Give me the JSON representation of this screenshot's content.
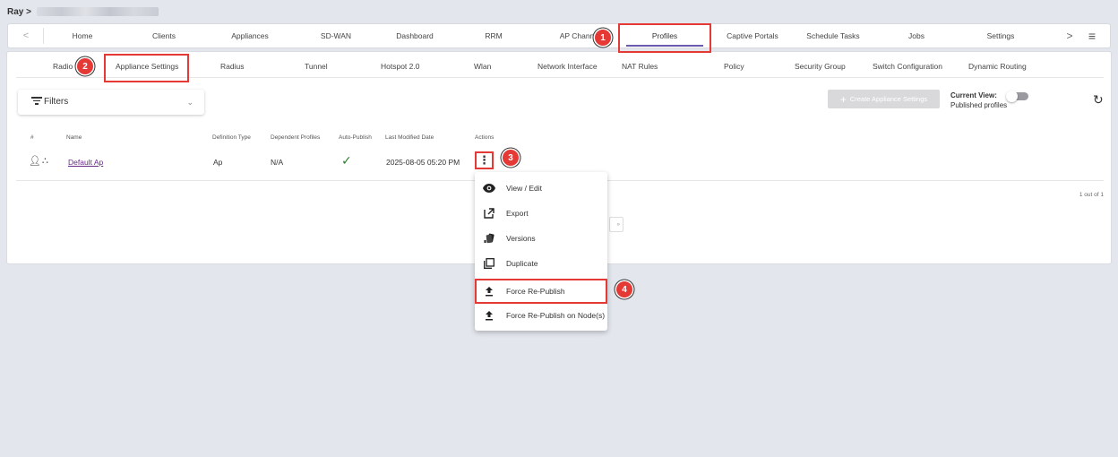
{
  "breadcrumb": {
    "root": "Ray >"
  },
  "top_nav": {
    "prev_arrow": "<",
    "next_arrow": ">",
    "menu_icon": "≡",
    "tabs": [
      {
        "label": "Home"
      },
      {
        "label": "Clients"
      },
      {
        "label": "Appliances"
      },
      {
        "label": "SD-WAN"
      },
      {
        "label": "Dashboard"
      },
      {
        "label": "RRM"
      },
      {
        "label": "AP Chann"
      },
      {
        "label": "Profiles"
      },
      {
        "label": "Captive Portals"
      },
      {
        "label": "Schedule Tasks"
      },
      {
        "label": "Jobs"
      },
      {
        "label": "Settings"
      }
    ],
    "active_tab": "Profiles"
  },
  "sub_nav": {
    "tabs": [
      {
        "label": "Radio"
      },
      {
        "label": "Appliance Settings"
      },
      {
        "label": "Radius"
      },
      {
        "label": "Tunnel"
      },
      {
        "label": "Hotspot 2.0"
      },
      {
        "label": "Wlan"
      },
      {
        "label": "Network Interface"
      },
      {
        "label": "NAT Rules"
      },
      {
        "label": "Policy"
      },
      {
        "label": "Security Group"
      },
      {
        "label": "Switch Configuration"
      },
      {
        "label": "Dynamic Routing"
      }
    ],
    "active_tab": "Appliance Settings"
  },
  "toolbar": {
    "filters_label": "Filters",
    "filters_chevron": "⌄",
    "create_plus": "+",
    "create_label": "Create Appliance Settings",
    "current_view_label": "Current View:",
    "current_view_value": "Published profiles",
    "refresh_icon": "↻"
  },
  "table": {
    "headers": [
      "#",
      "Name",
      "Definition Type",
      "Dependent Profiles",
      "Auto-Publish",
      "Last Modified Date",
      "Actions"
    ],
    "rows": [
      {
        "name": "Default Ap",
        "definition_type": "Ap",
        "dependent_profiles": "N/A",
        "auto_publish_icon": "✓",
        "last_modified": "2025-08-05 05:20 PM",
        "actions_icon": "⋮"
      }
    ],
    "pagination": "1 out of 1",
    "pager_next": "»"
  },
  "action_menu": {
    "items": [
      {
        "label": "View / Edit",
        "icon": "eye-icon"
      },
      {
        "label": "Export",
        "icon": "export-icon"
      },
      {
        "label": "Versions",
        "icon": "versions-icon"
      },
      {
        "label": "Duplicate",
        "icon": "duplicate-icon"
      },
      {
        "label": "Force Re-Publish",
        "icon": "upload-icon"
      },
      {
        "label": "Force Re-Publish on Node(s)",
        "icon": "upload-icon"
      }
    ]
  },
  "annotations": [
    "1",
    "2",
    "3",
    "4"
  ],
  "colors": {
    "accent": "#6a5bb0",
    "highlight": "#e53935",
    "check": "#2e7d32",
    "link": "#6a2a8a"
  }
}
